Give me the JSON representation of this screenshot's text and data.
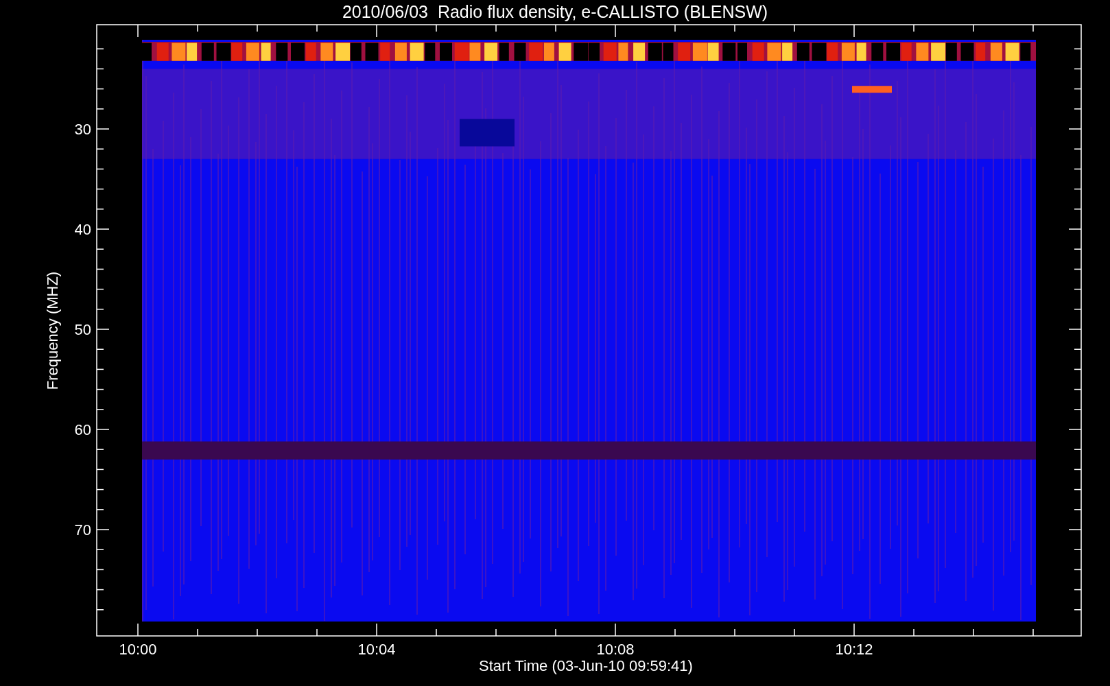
{
  "chart": {
    "title": "2010/06/03  Radio flux density, e-CALLISTO (BLENSW)",
    "ylabel": "Frequency (MHZ)",
    "xlabel": "Start Time (03-Jun-10 09:59:41)",
    "yticks": [
      "30",
      "40",
      "50",
      "60",
      "70"
    ],
    "xticks": [
      "10:00",
      "10:04",
      "10:08",
      "10:12"
    ]
  }
}
